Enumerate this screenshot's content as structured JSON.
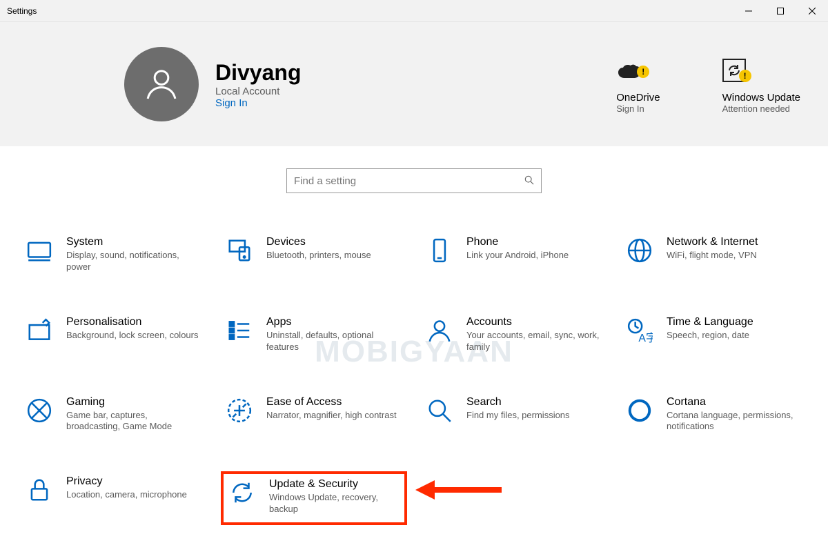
{
  "window": {
    "title": "Settings"
  },
  "user": {
    "name": "Divyang",
    "subtitle": "Local Account",
    "signin_label": "Sign In"
  },
  "tiles": {
    "onedrive": {
      "title": "OneDrive",
      "subtitle": "Sign In"
    },
    "update": {
      "title": "Windows Update",
      "subtitle": "Attention needed"
    }
  },
  "search": {
    "placeholder": "Find a setting"
  },
  "categories": [
    {
      "key": "system",
      "title": "System",
      "desc": "Display, sound, notifications, power"
    },
    {
      "key": "devices",
      "title": "Devices",
      "desc": "Bluetooth, printers, mouse"
    },
    {
      "key": "phone",
      "title": "Phone",
      "desc": "Link your Android, iPhone"
    },
    {
      "key": "network",
      "title": "Network & Internet",
      "desc": "WiFi, flight mode, VPN"
    },
    {
      "key": "personalisation",
      "title": "Personalisation",
      "desc": "Background, lock screen, colours"
    },
    {
      "key": "apps",
      "title": "Apps",
      "desc": "Uninstall, defaults, optional features"
    },
    {
      "key": "accounts",
      "title": "Accounts",
      "desc": "Your accounts, email, sync, work, family"
    },
    {
      "key": "time",
      "title": "Time & Language",
      "desc": "Speech, region, date"
    },
    {
      "key": "gaming",
      "title": "Gaming",
      "desc": "Game bar, captures, broadcasting, Game Mode"
    },
    {
      "key": "ease",
      "title": "Ease of Access",
      "desc": "Narrator, magnifier, high contrast"
    },
    {
      "key": "search",
      "title": "Search",
      "desc": "Find my files, permissions"
    },
    {
      "key": "cortana",
      "title": "Cortana",
      "desc": "Cortana language, permissions, notifications"
    },
    {
      "key": "privacy",
      "title": "Privacy",
      "desc": "Location, camera, microphone"
    },
    {
      "key": "update",
      "title": "Update & Security",
      "desc": "Windows Update, recovery, backup",
      "highlighted": true
    }
  ],
  "watermark": "MOBIGYAAN",
  "colors": {
    "accent": "#0067c0",
    "annotation": "#ff2a00",
    "warning": "#f6c500"
  }
}
